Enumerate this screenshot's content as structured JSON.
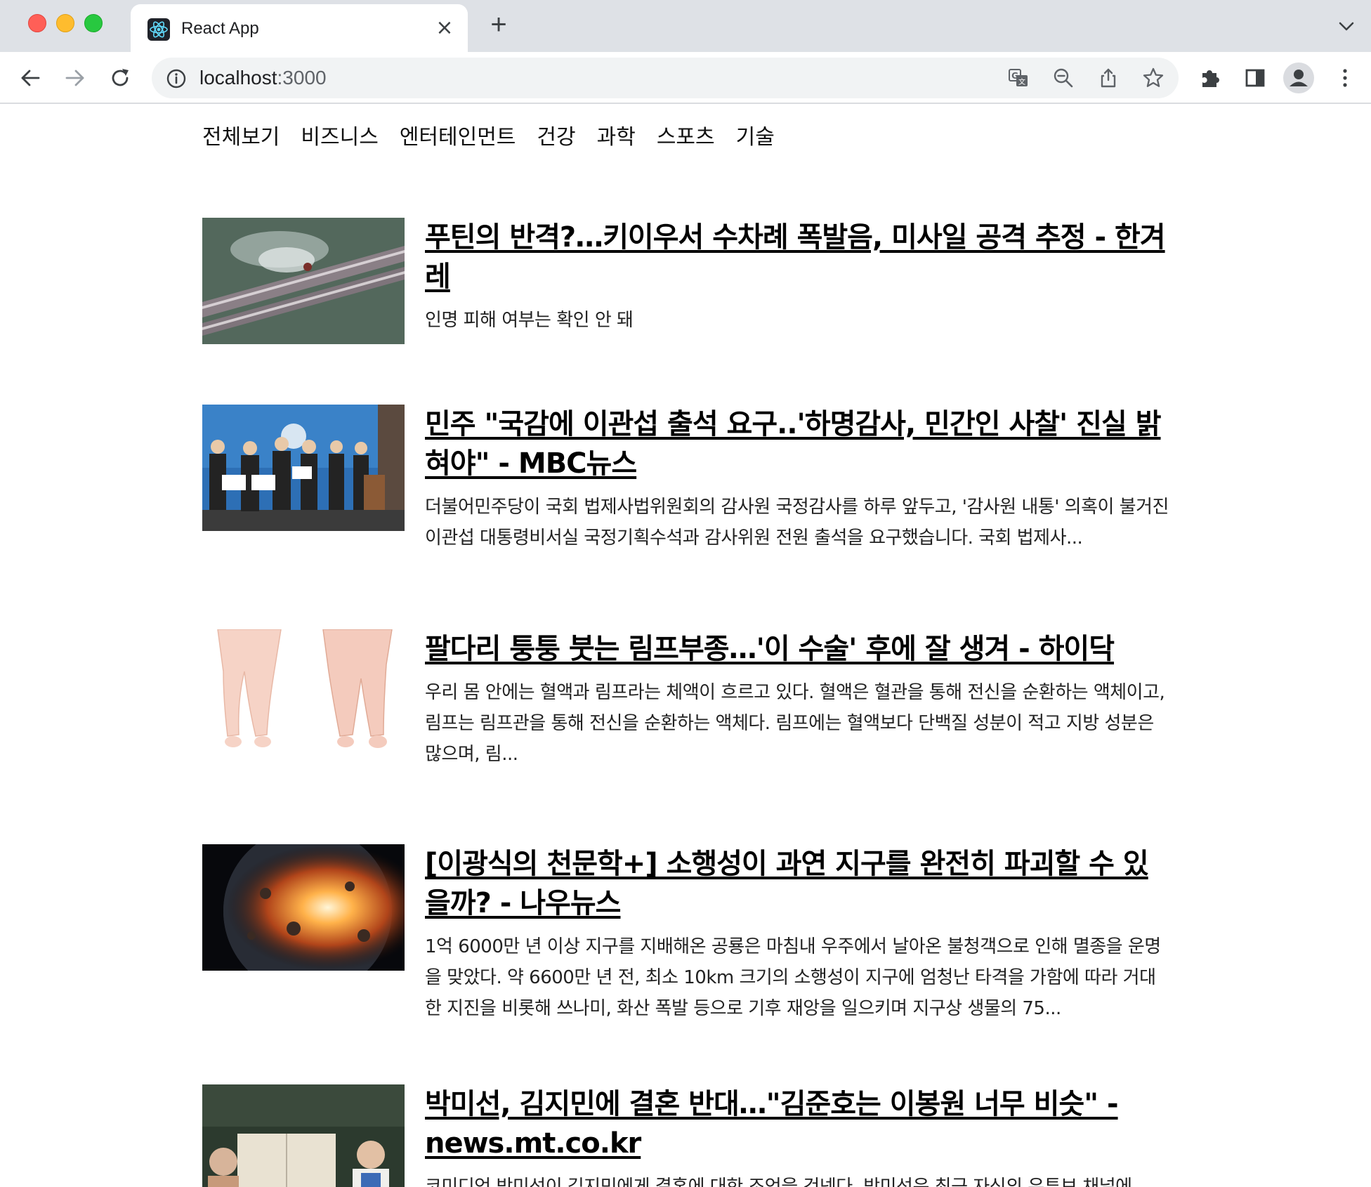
{
  "browser": {
    "tab": {
      "title": "React App"
    },
    "address_bar": {
      "host": "localhost",
      "port": ":3000"
    },
    "icons": {
      "back": "arrow-left-icon",
      "forward": "arrow-right-icon",
      "reload": "reload-icon",
      "info": "info-icon",
      "translate": "translate-icon",
      "zoom": "zoom-out-icon",
      "share": "share-icon",
      "bookmark": "star-icon",
      "extensions": "puzzle-icon",
      "side_panel": "side-panel-icon",
      "profile": "profile-icon",
      "menu": "kebab-menu-icon"
    }
  },
  "categories": [
    "전체보기",
    "비즈니스",
    "엔터테인먼트",
    "건강",
    "과학",
    "스포츠",
    "기술"
  ],
  "articles": [
    {
      "title": "푸틴의 반격?…키이우서 수차례 폭발음, 미사일 공격 추정 - 한겨레",
      "description": "인명 피해 여부는 확인 안 돼"
    },
    {
      "title": "민주 \"국감에 이관섭 출석 요구..'하명감사, 민간인 사찰' 진실 밝혀야\" - MBC뉴스",
      "description": "더불어민주당이 국회 법제사법위원회의 감사원 국정감사를 하루 앞두고, '감사원 내통' 의혹이 불거진 이관섭 대통령비서실 국정기획수석과 감사위원 전원 출석을 요구했습니다. 국회 법제사..."
    },
    {
      "title": "팔다리 퉁퉁 붓는 림프부종…'이 수술' 후에 잘 생겨 - 하이닥",
      "description": "우리 몸 안에는 혈액과 림프라는 체액이 흐르고 있다. 혈액은 혈관을 통해 전신을 순환하는 액체이고, 림프는 림프관을 통해 전신을 순환하는 액체다. 림프에는 혈액보다 단백질 성분이 적고 지방 성분은 많으며, 림..."
    },
    {
      "title": "[이광식의 천문학+] 소행성이 과연 지구를 완전히 파괴할 수 있을까? - 나우뉴스",
      "description": "1억 6000만 년 이상 지구를 지배해온 공룡은 마침내 우주에서 날아온 불청객으로 인해 멸종을 운명을 맞았다. 약 6600만 년 전, 최소 10km 크기의 소행성이 지구에 엄청난 타격을 가함에 따라 거대한 지진을 비롯해 쓰나미, 화산 폭발 등으로 기후 재앙을 일으키며 지구상 생물의 75..."
    },
    {
      "title": "박미선, 김지민에 결혼 반대…\"김준호는 이봉원 너무 비슷\" - news.mt.co.kr",
      "description": "코미디언 박미선이 김지민에게 결혼에 대한 조언을 건넨다. 박미선은 최근 자신의 유튜브 채널에"
    }
  ]
}
